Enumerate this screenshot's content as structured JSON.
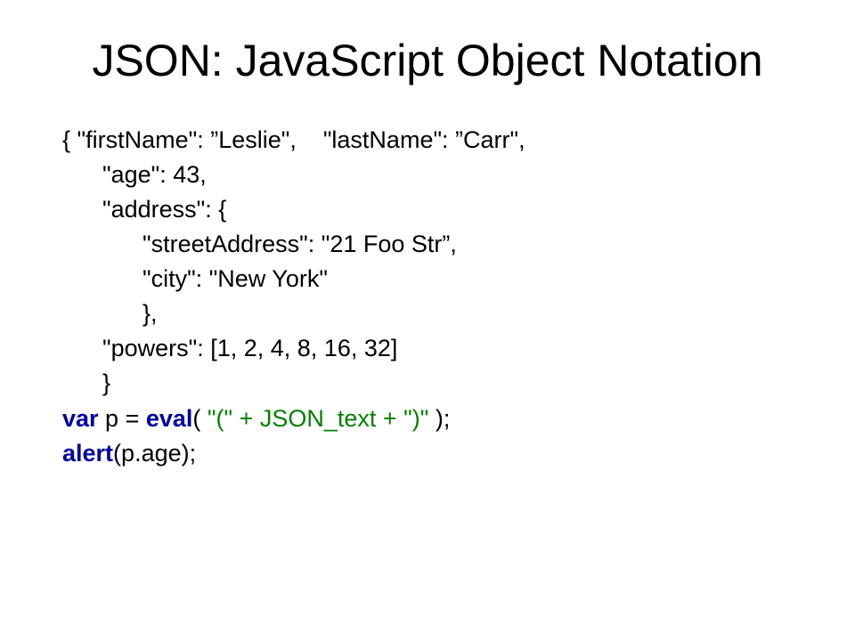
{
  "title": "JSON: JavaScript Object Notation",
  "code": {
    "l1": "{ \"firstName\": ”Leslie\",    \"lastName\": ”Carr\",",
    "l2": "      \"age\": 43,",
    "l3": "      \"address\": {",
    "l4": "            \"streetAddress\": \"21 Foo Str”,",
    "l5": "            \"city\": \"New York\"",
    "l6": "            },",
    "l7": "      \"powers\": [1, 2, 4, 8, 16, 32]",
    "l8": "      }",
    "js1": {
      "var": "var",
      "mid1": " p = ",
      "eval": "eval",
      "paren": "(",
      "arg": " \"(\" + JSON_text + \")\" ",
      "close": ");"
    },
    "js2": {
      "alert": "alert",
      "paren": "(",
      "arg": "p.age",
      "close": ");"
    }
  }
}
